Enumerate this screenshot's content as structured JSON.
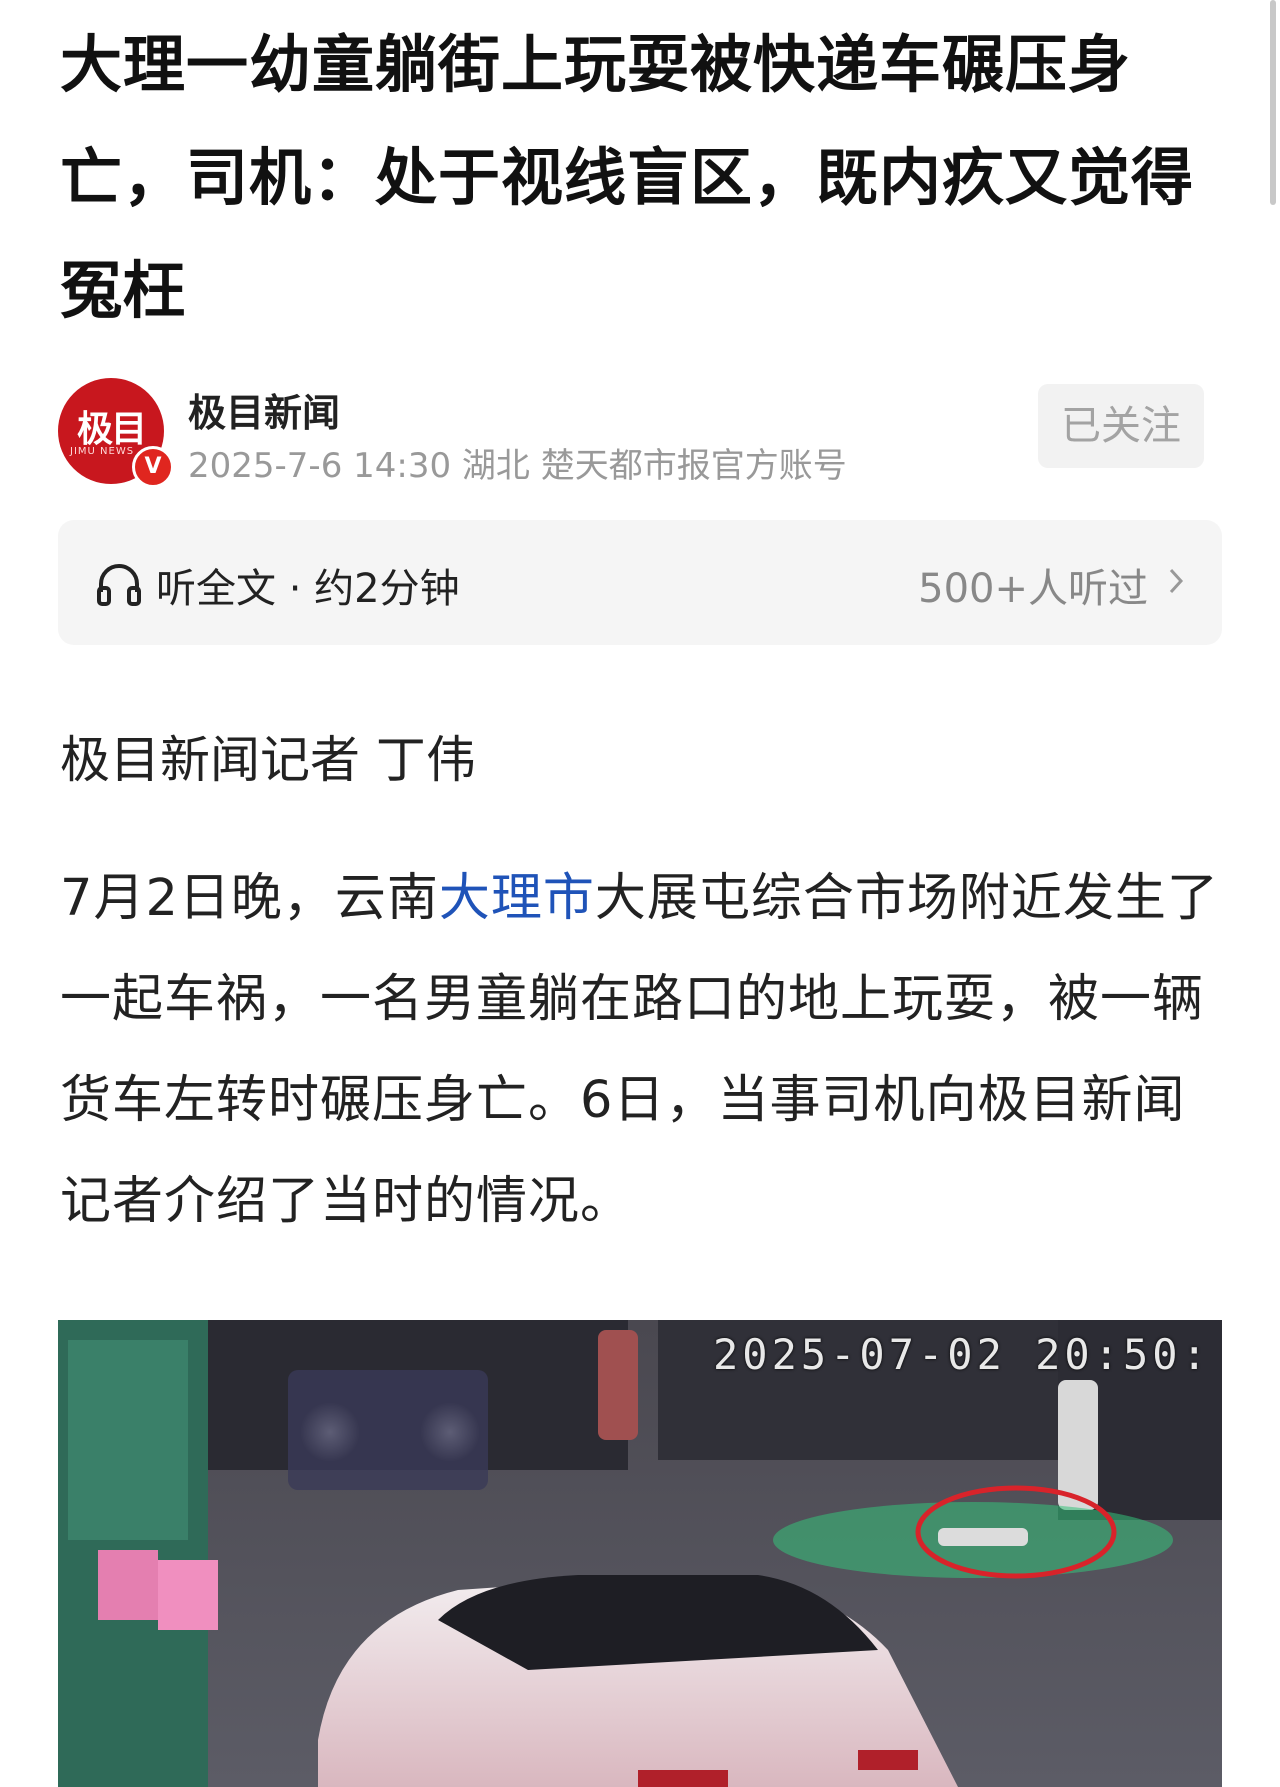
{
  "article": {
    "title": "大理一幼童躺街上玩耍被快递车碾压身亡，司机：处于视线盲区，既内疚又觉得冤枉",
    "author": {
      "name": "极目新闻",
      "avatar_text": "极目",
      "avatar_subtext": "JIMU NEWS",
      "verified_badge": "V",
      "meta": "2025-7-6 14:30 湖北 楚天都市报官方账号"
    },
    "follow_label": "已关注",
    "listen": {
      "icon": "headphone-icon",
      "label": "听全文 · 约2分钟",
      "count": "500+人听过"
    },
    "reporter": "极目新闻记者 丁伟",
    "body": {
      "part1": "7月2日晚，云南",
      "link": "大理市",
      "part2": "大展屯综合市场附近发生了一起车祸，一名男童躺在路口的地上玩耍，被一辆货车左转时碾压身亡。6日，当事司机向极目新闻记者介绍了当时的情况。"
    },
    "image": {
      "timestamp": "2025-07-02 20:50:"
    }
  },
  "colors": {
    "brand_red": "#c8171e",
    "link_blue": "#1f53b8",
    "annotation_red": "#d8232a"
  }
}
